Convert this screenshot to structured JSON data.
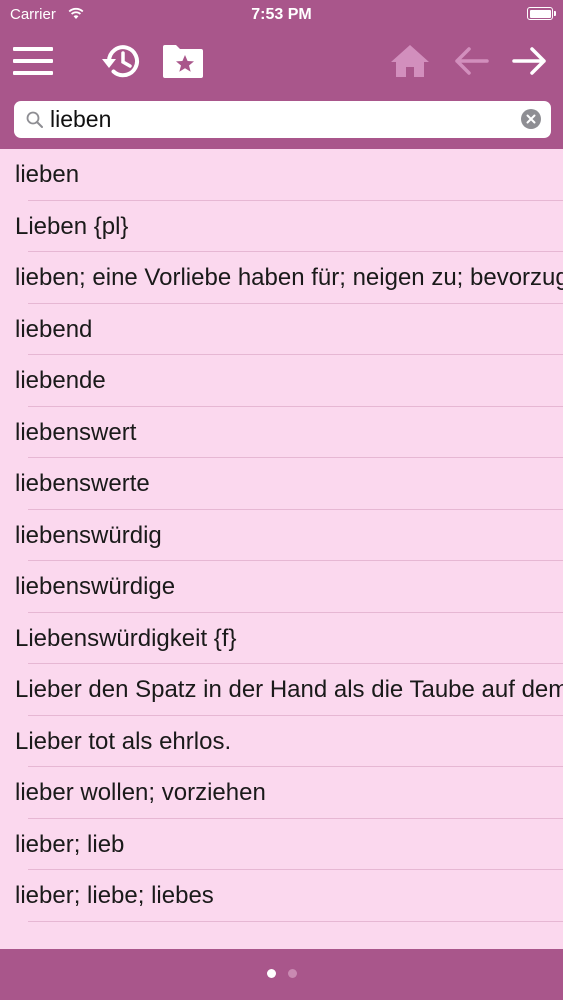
{
  "status": {
    "carrier": "Carrier",
    "time": "7:53 PM"
  },
  "search": {
    "value": "lieben"
  },
  "results": [
    "lieben",
    "Lieben {pl}",
    "lieben; eine Vorliebe haben für; neigen zu; bevorzugen",
    "liebend",
    "liebende",
    "liebenswert",
    "liebenswerte",
    "liebenswürdig",
    "liebenswürdige",
    "Liebenswürdigkeit {f}",
    "Lieber den Spatz in der Hand als die Taube auf dem Dach.",
    "Lieber tot als ehrlos.",
    "lieber wollen; vorziehen",
    "lieber; lieb",
    "lieber; liebe; liebes"
  ],
  "colors": {
    "bar": "#a9568b",
    "list_bg": "#fbd8ee",
    "disabled_icon": "#d28fbd"
  },
  "pager": {
    "count": 2,
    "active": 0
  }
}
